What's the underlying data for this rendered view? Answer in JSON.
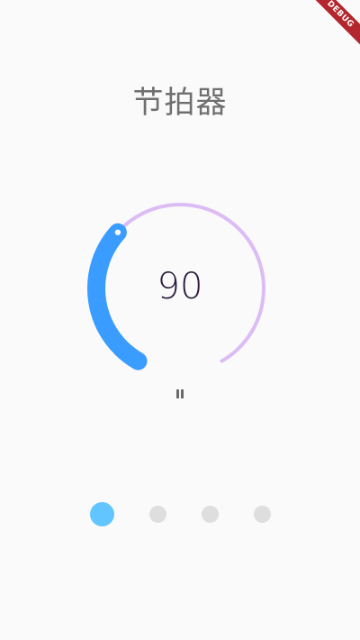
{
  "app": {
    "title": "节拍器",
    "debug_banner": "DEBUG"
  },
  "metronome": {
    "bpm_display": "90",
    "bpm_fraction": 0.34,
    "active_color": "#3a9cff",
    "track_color": "#dcbcf5",
    "state_icon": "pause-icon"
  },
  "pager": {
    "page_count": 4,
    "active_index": 0,
    "active_color": "#63c5ff",
    "inactive_color": "#dedede"
  }
}
